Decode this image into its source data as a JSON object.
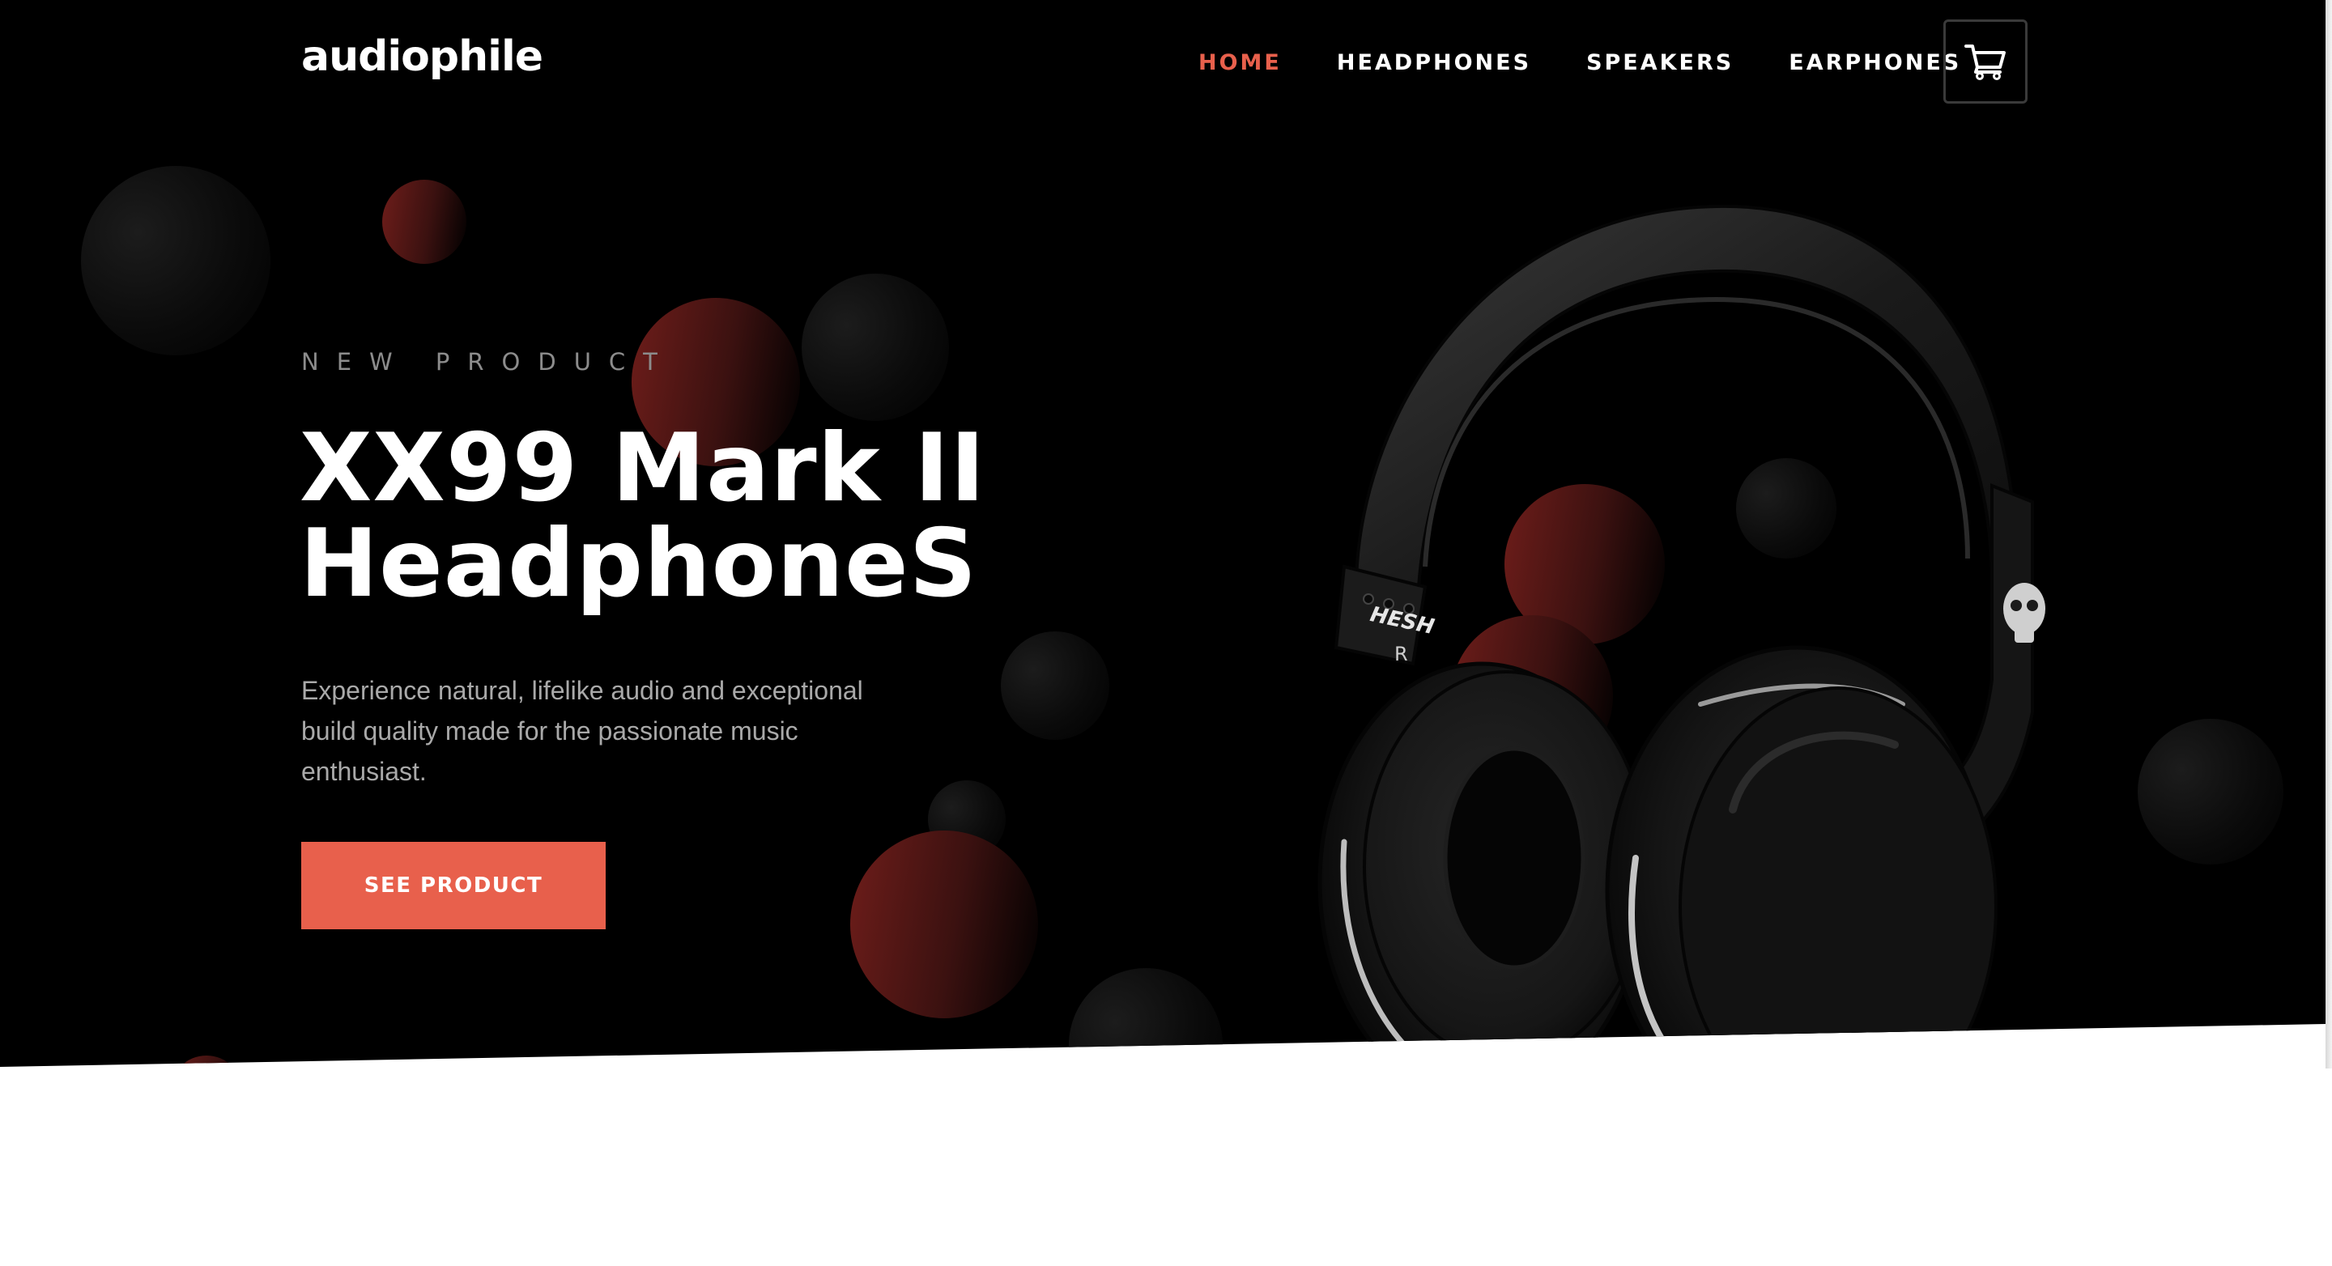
{
  "brand": {
    "logo_text": "audiophile"
  },
  "nav": {
    "items": [
      {
        "label": "HOME",
        "active": true
      },
      {
        "label": "HEADPHONES",
        "active": false
      },
      {
        "label": "SPEAKERS",
        "active": false
      },
      {
        "label": "EARPHONES",
        "active": false
      }
    ],
    "cart_icon": "cart-icon"
  },
  "hero": {
    "eyebrow": "NEW PRODUCT",
    "title_line1": "XX99 Mark II",
    "title_line2": "HeadphoneS",
    "description": "Experience natural, lifelike audio and exceptional build quality made for the passionate music enthusiast.",
    "cta_label": "SEE PRODUCT",
    "product_logo_text": "HESH",
    "product_side_text": "R"
  },
  "colors": {
    "accent": "#e8604c",
    "hero_background": "#000000",
    "text_primary": "#ffffff",
    "text_muted": "#a9a9a9",
    "page_background": "#ffffff"
  }
}
